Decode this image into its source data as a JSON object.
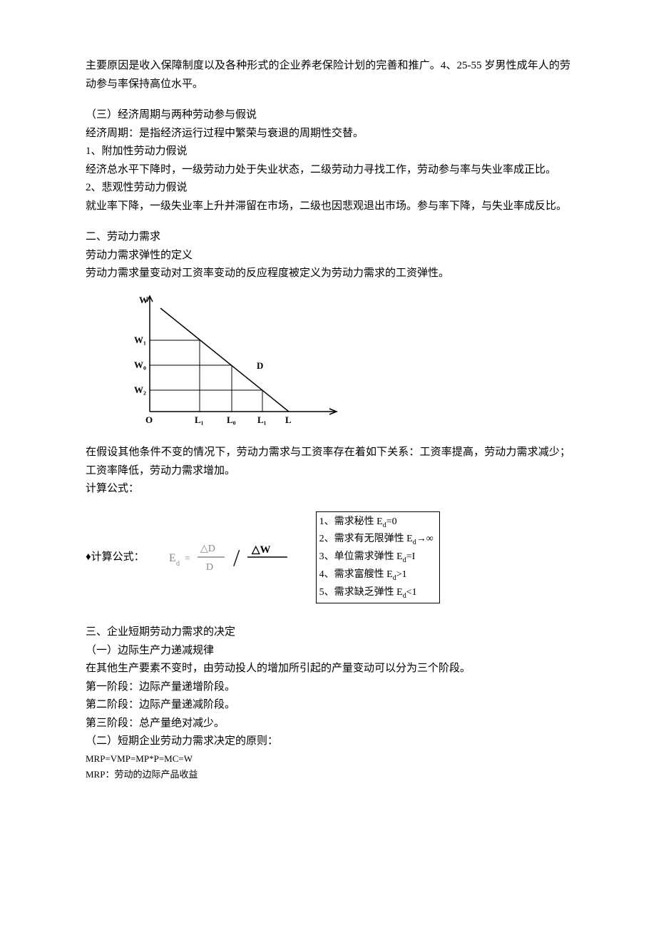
{
  "intro": {
    "p1": "主要原因是收入保障制度以及各种形式的企业养老保险计划的完善和推广。4、25-55 岁男性成年人的劳动参与率保持高位水平。"
  },
  "sec3": {
    "title": "（三）经济周期与两种劳动参与假说",
    "def": "经济周期：是指经济运行过程中繁荣与衰退的周期性交替。",
    "h1": "1、附加性劳动力假说",
    "h1body": "经济总水平下降时，一级劳动力处于失业状态，二级劳动力寻找工作，劳动参与率与失业率成正比。",
    "h2": "2、悲观性劳动力假说",
    "h2body": "就业率下降，一级失业率上升并滞留在市场，二级也因悲观退出市场。参与率下降，与失业率成反比。"
  },
  "demand": {
    "title": "二、劳动力需求",
    "sub": "劳动力需求弹性的定义",
    "def": "劳动力需求量变动对工资率变动的反应程度被定义为劳动力需求的工资弹性。",
    "relation": "在假设其他条件不变的情况下，劳动力需求与工资率存在着如下关系：工资率提高，劳动力需求减少；工资率降低，劳动力需求增加。",
    "calc": "计算公式：",
    "calc2": "♦计算公式：",
    "graph": {
      "W": "W",
      "W1": "W₁",
      "W0": "W₀",
      "W2": "W₂",
      "O": "O",
      "L1a": "L₁",
      "L0": "L₀",
      "L1b": "L₁",
      "L": "L",
      "D": "D"
    },
    "formula": {
      "Ed": "E",
      "d": "d",
      "eq": "=",
      "dD": "△D",
      "D": "D",
      "slash": "/",
      "dW": "△W"
    },
    "box": {
      "l1a": "1、需求秘性 E",
      "l1b": "=0",
      "l2a": "2、需求有无限弹性 E",
      "l2b": "→∞",
      "l3a": "3、单位需求弹性 E",
      "l3b": "=I",
      "l4a": "4、需求富艘性 E",
      "l4b": ">1",
      "l5a": "5、需求缺乏弹性 E",
      "l5b": "<1"
    }
  },
  "short": {
    "title": "三、企业短期劳动力需求的决定",
    "s1t": "（一）边际生产力递减规律",
    "s1b": "在其他生产要素不变时，由劳动投人的增加所引起的产量变动可以分为三个阶段。",
    "ph1": "第一阶段：边际产量递增阶段。",
    "ph2": "第二阶段：边际产量递减阶段。",
    "ph3": "第三阶段：总产量绝对减少。",
    "s2t": "（二）短期企业劳动力需求决定的原则：",
    "eq": "MRP=VMP=MP*P=MC=W",
    "mrp": "MRP：劳动的边际产品收益"
  }
}
